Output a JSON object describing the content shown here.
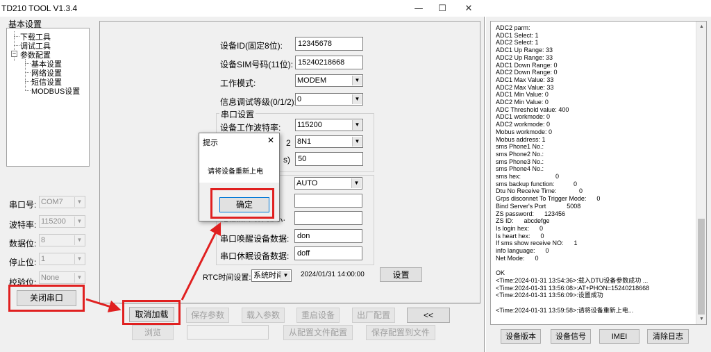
{
  "app_title": "TD210 TOOL V1.3.4",
  "window_controls": {
    "minimize": "—",
    "maximize": "☐",
    "close": "✕"
  },
  "tree": {
    "header": "基本设置",
    "items": [
      {
        "label": "下载工具"
      },
      {
        "label": "调试工具"
      },
      {
        "label": "参数配置",
        "expander": "−"
      },
      {
        "label": "基本设置"
      },
      {
        "label": "网络设置"
      },
      {
        "label": "短信设置"
      },
      {
        "label": "MODBUS设置"
      }
    ]
  },
  "serial_panel": {
    "port_label": "串口号:",
    "port_value": "COM7",
    "baud_label": "波特率:",
    "baud_value": "115200",
    "data_label": "数据位:",
    "data_value": "8",
    "stop_label": "停止位:",
    "stop_value": "1",
    "parity_label": "校验位:",
    "parity_value": "None",
    "close_button": "关闭串口"
  },
  "form": {
    "device_id_label": "设备ID(固定8位):",
    "device_id_value": "12345678",
    "sim_label": "设备SIM号码(11位):",
    "sim_value": "15240218668",
    "work_mode_label": "工作模式:",
    "work_mode_value": "MODEM",
    "debug_level_label": "信息调试等级(0/1/2):",
    "debug_level_value": "0",
    "serial_group_title": "串口设置",
    "baud_label": "设备工作波特率:",
    "baud_value": "115200",
    "format_label_partial": "2",
    "format_value": "8N1",
    "timeout_label_partial": "s)",
    "timeout_value": "50",
    "auto_value": "AUTO",
    "obscured_label": "短信回车器(3)(S):",
    "wake_label": "串口唤醒设备数据:",
    "wake_value": "don",
    "sleep_label": "串口休眠设备数据:",
    "sleep_value": "doff",
    "rtc_label": "RTC时间设置:",
    "rtc_mode": "系统时间",
    "rtc_time": "2024/01/31 14:00:00",
    "set_button": "设置"
  },
  "bottom_buttons": {
    "cancel_load": "取消加载",
    "save_params": "保存参数",
    "load_params": "载入参数",
    "restart_device": "重启设备",
    "factory_config": "出厂配置",
    "collapse": "<<",
    "browse": "浏览",
    "from_config_file": "从配置文件配置",
    "save_config_file": "保存配置到文件"
  },
  "dialog": {
    "title": "提示",
    "close": "✕",
    "message": "请将设备重新上电",
    "ok_button": "确定"
  },
  "log": {
    "lines": [
      "ADC2 parm:",
      "ADC1 Select: 1",
      "ADC2 Select: 1",
      "ADC1 Up Range: 33",
      "ADC2 Up Range: 33",
      "ADC1 Down Range: 0",
      "ADC2 Down Range: 0",
      "ADC1 Max Value: 33",
      "ADC2 Max Value: 33",
      "ADC1 Min Value: 0",
      "ADC2 Min Value: 0",
      "ADC Threshold value: 400",
      "ADC1 workmode: 0",
      "ADC2 workmode: 0",
      "Mobus workmode: 0",
      "Mobus address: 1",
      "sms Phone1 No.:",
      "sms Phone2 No.:",
      "sms Phone3 No.:",
      "sms Phone4 No.:",
      "sms hex:                    0",
      "sms backup function:           0",
      "Dtu No Receive Time:             0",
      "Grps disconnet To Trigger Mode:      0",
      "Bind Server's Port            5008",
      "ZS password:      123456",
      "ZS ID:      abcdefge",
      "Is login hex:      0",
      "Is heart hex:      0",
      "If sms show receive NO:      1",
      "info language:      0",
      "Net Mode:      0",
      "",
      "OK",
      "<Time:2024-01-31 13:54:36>:载入DTU设备参数成功 ...",
      "<Time:2024-01-31 13:56:08>:AT+PHON=15240218668",
      "<Time:2024-01-31 13:56:09>:设置成功",
      "",
      "<Time:2024-01-31 13:59:58>:请将设备重新上电..."
    ],
    "buttons": {
      "version": "设备版本",
      "signal": "设备信号",
      "imei": "IMEI",
      "clear": "清除日志"
    }
  },
  "colors": {
    "annotation_red": "#e02020",
    "window_bg": "#f0f0f0"
  }
}
